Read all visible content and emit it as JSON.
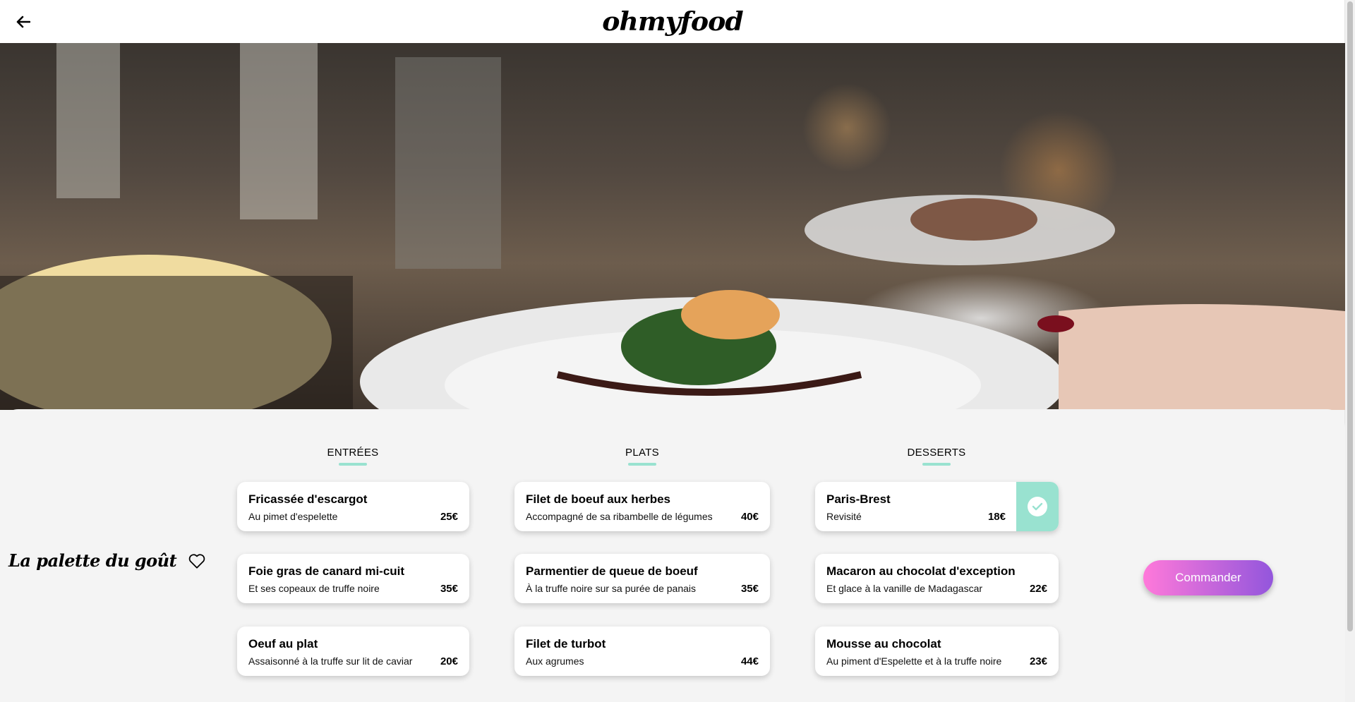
{
  "header": {
    "logo": "ohmyfood",
    "back_icon": "arrow-left-icon"
  },
  "hero": {
    "image": "restaurant-table-photo"
  },
  "restaurant": {
    "name": "La palette du goût",
    "favorite_icon": "heart-outline-icon"
  },
  "menu": {
    "columns": [
      {
        "title": "ENTRÉES",
        "items": [
          {
            "name": "Fricassée d'escargot",
            "desc": "Au pimet d'espelette",
            "price": "25€"
          },
          {
            "name": "Foie gras de canard mi-cuit",
            "desc": "Et ses copeaux de truffe noire",
            "price": "35€"
          },
          {
            "name": "Oeuf au plat",
            "desc": "Assaisonné à la truffe sur lit de caviar",
            "price": "20€"
          }
        ]
      },
      {
        "title": "PLATS",
        "items": [
          {
            "name": "Filet de boeuf aux herbes",
            "desc": "Accompagné de sa ribambelle de légumes",
            "price": "40€"
          },
          {
            "name": "Parmentier de queue de boeuf",
            "desc": "À la truffe noire sur sa purée de panais",
            "price": "35€"
          },
          {
            "name": "Filet de turbot",
            "desc": "Aux agrumes",
            "price": "44€"
          }
        ]
      },
      {
        "title": "DESSERTS",
        "items": [
          {
            "name": "Paris-Brest",
            "desc": "Revisité",
            "price": "18€",
            "selected": true
          },
          {
            "name": "Macaron au chocolat d'exception",
            "desc": "Et glace à la vanille de Madagascar",
            "price": "22€"
          },
          {
            "name": "Mousse au chocolat",
            "desc": "Au piment d'Espelette et à la truffe noire",
            "price": "23€"
          }
        ]
      }
    ]
  },
  "order_button": {
    "label": "Commander"
  },
  "colors": {
    "accent_mint": "#99e2d0",
    "button_gradient_start": "#ff79da",
    "button_gradient_end": "#9356dc"
  }
}
